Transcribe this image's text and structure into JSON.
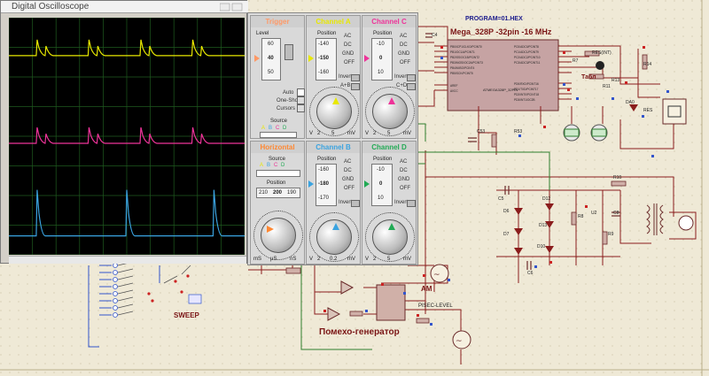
{
  "window": {
    "title": "Digital Oscilloscope"
  },
  "trigger": {
    "title": "Trigger",
    "level_label": "Level",
    "level_values": [
      "60",
      "40",
      "50"
    ],
    "options": [
      "Auto",
      "One-Shot",
      "Cursors"
    ],
    "source_label": "Source",
    "source_letters": [
      "A",
      "B",
      "C",
      "D"
    ],
    "color": "#ff9966"
  },
  "horizontal": {
    "title": "Horizontal",
    "source_label": "Source",
    "source_letters": [
      "A",
      "B",
      "C",
      "D"
    ],
    "position_label": "Position",
    "position_values": [
      "210",
      "200",
      "190"
    ],
    "units": [
      "mS",
      "µS",
      "nS"
    ],
    "color": "#ff8833"
  },
  "channels": [
    {
      "id": "A",
      "title": "Channel A",
      "color": "#e8e800",
      "position_label": "Position",
      "position_values": [
        "-140",
        "-150",
        "-160"
      ],
      "coupling": [
        "AC",
        "DC",
        "GND",
        "OFF"
      ],
      "invert": "Invert",
      "mode": "A+B",
      "scale": [
        "2",
        "5",
        "mV"
      ],
      "axis_label": "V"
    },
    {
      "id": "B",
      "title": "Channel B",
      "color": "#3aa3e0",
      "position_label": "Position",
      "position_values": [
        "-160",
        "-180",
        "-170"
      ],
      "coupling": [
        "AC",
        "DC",
        "GND",
        "OFF"
      ],
      "invert": "Invert",
      "mode": "",
      "scale": [
        "2",
        "0.2",
        "mV"
      ],
      "axis_label": "V"
    },
    {
      "id": "C",
      "title": "Channel C",
      "color": "#ee3399",
      "position_label": "Position",
      "position_values": [
        "-10",
        "0",
        "10"
      ],
      "coupling": [
        "AC",
        "DC",
        "GND",
        "OFF"
      ],
      "invert": "Invert",
      "mode": "C+D",
      "scale": [
        "2",
        "5",
        "mV"
      ],
      "axis_label": "V"
    },
    {
      "id": "D",
      "title": "Channel D",
      "color": "#22aa55",
      "position_label": "Position",
      "position_values": [
        "-10",
        "0",
        "10"
      ],
      "coupling": [
        "AC",
        "DC",
        "GND",
        "OFF"
      ],
      "invert": "Invert",
      "mode": "",
      "scale": [
        "2",
        "5",
        "mV"
      ],
      "axis_label": "V"
    }
  ],
  "screen": {
    "traces": [
      {
        "name": "A",
        "color": "#e8e800",
        "level": 0.16,
        "pulses": [
          0.12,
          0.34,
          0.56,
          0.78
        ]
      },
      {
        "name": "C",
        "color": "#ee3399",
        "level": 0.53,
        "pulses": [
          0.12,
          0.34,
          0.56,
          0.78
        ]
      },
      {
        "name": "B",
        "color": "#3aa3e0",
        "level": 0.92,
        "pulses": [
          0.12,
          0.5,
          0.87
        ]
      }
    ]
  },
  "schematic": {
    "program_label": "PROGRAM=01.HEX",
    "mcu_label": "Mega_328P -32pin -16 MHz",
    "mcu_part": "ATMEGA328P_32PIN",
    "am_label": "AM",
    "sweep_label": "SWEEP",
    "pisec_label": "PISEC-LEVEL",
    "generator_label": "Помехо-генератор",
    "parts": [
      "C4",
      "R14",
      "RES(INT)",
      "R7",
      "R13",
      "Табл",
      "R11",
      "C53",
      "R53",
      "RES",
      "C5",
      "D12",
      "R8",
      "C8",
      "D6",
      "D13",
      "U2",
      "D7",
      "D10",
      "R9",
      "C6",
      "R10",
      "DA0"
    ]
  }
}
